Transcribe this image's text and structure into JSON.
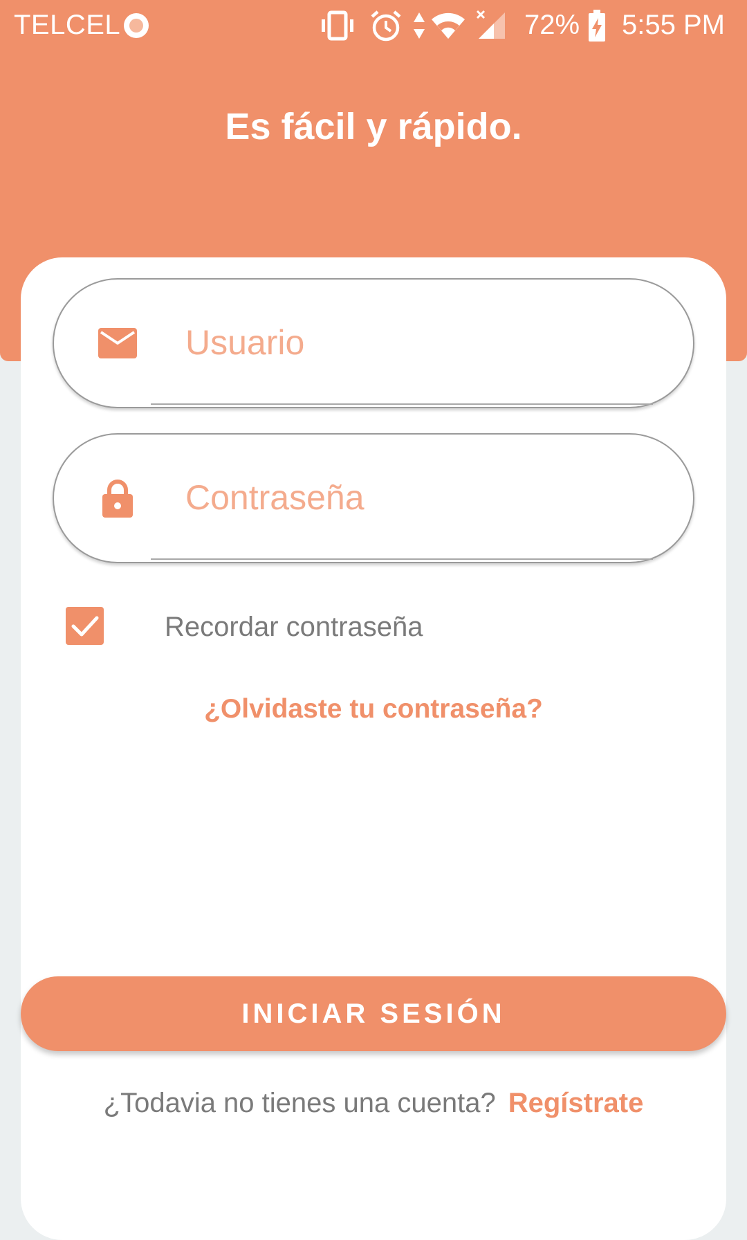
{
  "status_bar": {
    "carrier": "TELCEL",
    "battery_percent": "72%",
    "time": "5:55 PM",
    "icons": [
      "record-dot-icon",
      "vibrate-icon",
      "alarm-icon",
      "data-arrows-icon",
      "wifi-icon",
      "signal-icon",
      "battery-charging-icon"
    ]
  },
  "header": {
    "title": "Es fácil y rápido."
  },
  "form": {
    "username": {
      "placeholder": "Usuario",
      "icon": "mail-icon",
      "value": ""
    },
    "password": {
      "placeholder": "Contraseña",
      "icon": "lock-icon",
      "value": ""
    },
    "remember": {
      "label": "Recordar contraseña",
      "checked": true
    },
    "forgot_link": "¿Olvidaste tu contraseña?",
    "login_button": "INICIAR SESIÓN"
  },
  "signup": {
    "prompt": "¿Todavia no tienes una cuenta?",
    "link": "Regístrate"
  },
  "colors": {
    "accent": "#f0906a",
    "placeholder": "#f4ab8d",
    "background": "#ebeff0",
    "card": "#ffffff"
  }
}
